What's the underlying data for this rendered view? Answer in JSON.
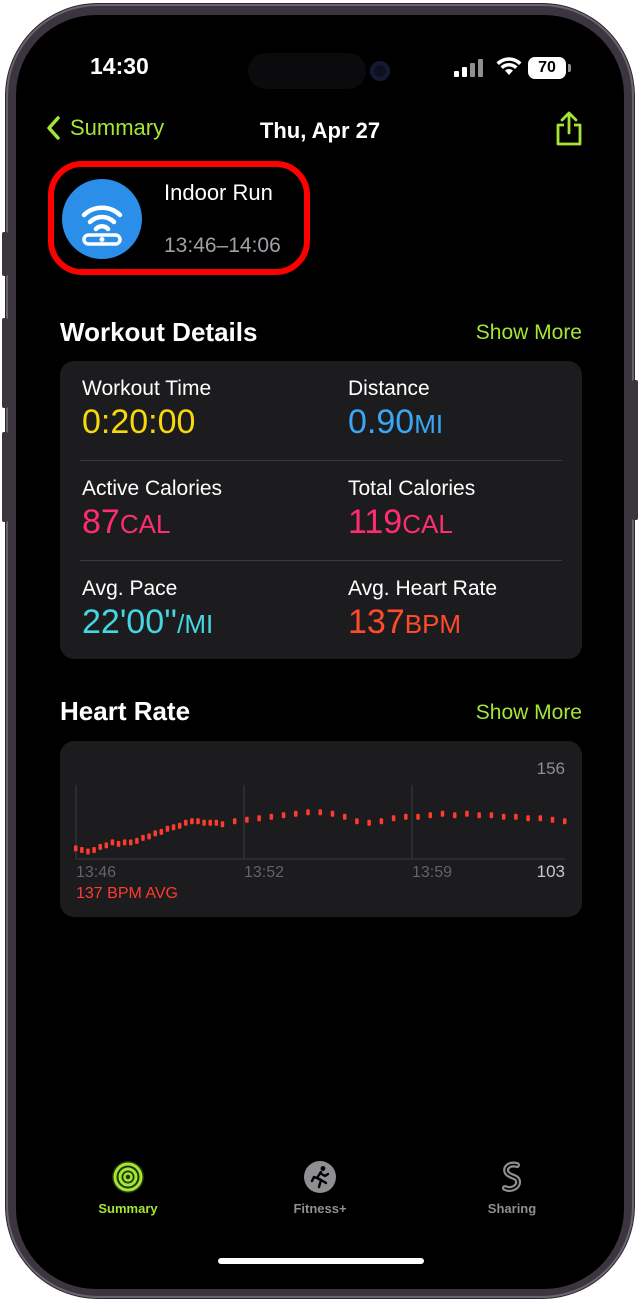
{
  "status": {
    "time": "14:30",
    "battery": "70"
  },
  "nav": {
    "back_label": "Summary",
    "title": "Thu, Apr 27"
  },
  "workout": {
    "name": "Indoor Run",
    "time_range": "13:46–14:06"
  },
  "details": {
    "title": "Workout Details",
    "show_more": "Show More",
    "metrics": [
      {
        "label": "Workout Time",
        "value": "0:20:00",
        "unit": "",
        "color": "#f5d90a"
      },
      {
        "label": "Distance",
        "value": "0.90",
        "unit": "MI",
        "color": "#3aa7f5"
      },
      {
        "label": "Active Calories",
        "value": "87",
        "unit": "CAL",
        "color": "#ff2d6f"
      },
      {
        "label": "Total Calories",
        "value": "119",
        "unit": "CAL",
        "color": "#ff2d6f"
      },
      {
        "label": "Avg. Pace",
        "value": "22'00''",
        "unit": "/MI",
        "color": "#45d6e6"
      },
      {
        "label": "Avg. Heart Rate",
        "value": "137",
        "unit": "BPM",
        "color": "#ff4b2b"
      }
    ]
  },
  "heart": {
    "title": "Heart Rate",
    "show_more": "Show More",
    "max_label": "156",
    "min_label": "103",
    "time_labels": [
      "13:46",
      "13:52",
      "13:59"
    ],
    "avg_label": "137 BPM AVG",
    "color": "#ff3b2f"
  },
  "chart_data": {
    "type": "scatter",
    "title": "Heart Rate",
    "ylim": [
      103,
      156
    ],
    "x_ticks": [
      "13:46",
      "13:52",
      "13:59"
    ],
    "x": [
      0,
      0.25,
      0.5,
      0.75,
      1,
      1.25,
      1.5,
      1.75,
      2,
      2.25,
      2.5,
      2.75,
      3,
      3.25,
      3.5,
      3.75,
      4,
      4.25,
      4.5,
      4.75,
      5,
      5.25,
      5.5,
      5.75,
      6,
      6.5,
      7,
      7.5,
      8,
      8.5,
      9,
      9.5,
      10,
      10.5,
      11,
      11.5,
      12,
      12.5,
      13,
      13.5,
      14,
      14.5,
      15,
      15.5,
      16,
      16.5,
      17,
      17.5,
      18,
      18.5,
      19,
      19.5,
      20
    ],
    "values": [
      110,
      109,
      108,
      109,
      111,
      112,
      114,
      113,
      114,
      114,
      115,
      117,
      118,
      120,
      121,
      123,
      124,
      125,
      127,
      128,
      128,
      127,
      127,
      127,
      126,
      128,
      129,
      130,
      131,
      132,
      133,
      134,
      134,
      133,
      131,
      128,
      127,
      128,
      130,
      131,
      131,
      132,
      133,
      132,
      133,
      132,
      132,
      131,
      131,
      130,
      130,
      129,
      128
    ]
  },
  "tabs": [
    {
      "label": "Summary",
      "icon": "activity-rings-icon",
      "color": "#a4e536"
    },
    {
      "label": "Fitness+",
      "icon": "runner-icon",
      "color": "#8e8e93"
    },
    {
      "label": "Sharing",
      "icon": "sharing-icon",
      "color": "#8e8e93"
    }
  ]
}
